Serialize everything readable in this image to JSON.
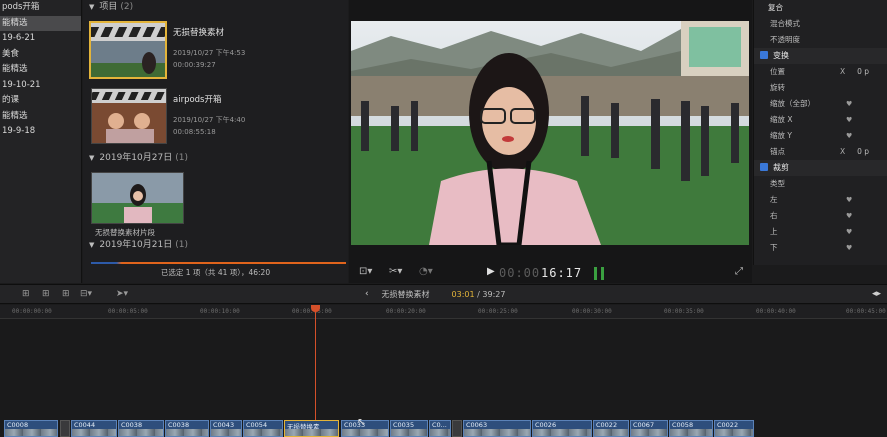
{
  "sidebar": {
    "items": [
      {
        "label": "pods开箱",
        "selected": false
      },
      {
        "label": "能精选",
        "selected": true
      },
      {
        "label": "19-6-21",
        "selected": false
      },
      {
        "label": "美食",
        "selected": false
      },
      {
        "label": "能精选",
        "selected": false
      },
      {
        "label": "19-10-21",
        "selected": false
      },
      {
        "label": "的课",
        "selected": false
      },
      {
        "label": "能精选",
        "selected": false
      },
      {
        "label": "19-9-18",
        "selected": false
      }
    ]
  },
  "browser": {
    "groups": [
      {
        "name": "项目",
        "count": "(2)"
      },
      {
        "name": "2019年10月27日",
        "count": "(1)"
      },
      {
        "name": "2019年10月21日",
        "count": "(1)"
      }
    ],
    "clips": [
      {
        "name": "无损替换素材",
        "date": "2019/10/27 下午4:53",
        "duration": "00:00:39:27"
      },
      {
        "name": "airpods开箱",
        "date": "2019/10/27 下午4:40",
        "duration": "00:08:55:18"
      }
    ],
    "event_clip_caption": "无损替换素材片段",
    "status": "已选定 1 项（共 41 项），46:20"
  },
  "viewer": {
    "timecode_dim": "00:00",
    "timecode_bright": "16:17"
  },
  "inspector": {
    "rows": [
      {
        "type": "sec-plain",
        "label": "复合"
      },
      {
        "type": "row",
        "label": "混合模式"
      },
      {
        "type": "row",
        "label": "不透明度"
      },
      {
        "type": "sec",
        "label": "变换"
      },
      {
        "type": "row",
        "label": "位置",
        "x": "X",
        "val": "0 p"
      },
      {
        "type": "row",
        "label": "旋转"
      },
      {
        "type": "row",
        "label": "缩放（全部）",
        "kf": "♥"
      },
      {
        "type": "row",
        "label": "缩放 X",
        "kf": "♥"
      },
      {
        "type": "row",
        "label": "缩放 Y",
        "kf": "♥"
      },
      {
        "type": "row",
        "label": "锚点",
        "x": "X",
        "val": "0 p"
      },
      {
        "type": "sec",
        "label": "裁剪"
      },
      {
        "type": "row",
        "label": "类型"
      },
      {
        "type": "row",
        "label": "左",
        "kf": "♥"
      },
      {
        "type": "row",
        "label": "右",
        "kf": "♥"
      },
      {
        "type": "row",
        "label": "上",
        "kf": "♥"
      },
      {
        "type": "row",
        "label": "下",
        "kf": "♥"
      }
    ]
  },
  "toolbar": {
    "project_name": "无损替换素材",
    "current_time": "03:01",
    "total_time": "39:27"
  },
  "ruler": {
    "ticks": [
      "00:00:00:00",
      "00:00:05:00",
      "00:00:10:00",
      "00:00:15:00",
      "00:00:20:00",
      "00:00:25:00",
      "00:00:30:00",
      "00:00:35:00",
      "00:00:40:00",
      "00:00:45:00"
    ]
  },
  "storyline": {
    "clips": [
      "C0008",
      "C0044",
      "C0038",
      "C0038",
      "C0043",
      "C0054",
      "无损替换素",
      "C0033",
      "C0035",
      "C0...",
      "C0063",
      "C0026",
      "C0022",
      "C0067",
      "C0058",
      "C0022"
    ]
  },
  "colors": {
    "accent_selection": "#e3b43a",
    "playhead": "#d4502a",
    "checkbox_blue": "#3a78d8",
    "clip_blue": "#2e4e7c"
  }
}
